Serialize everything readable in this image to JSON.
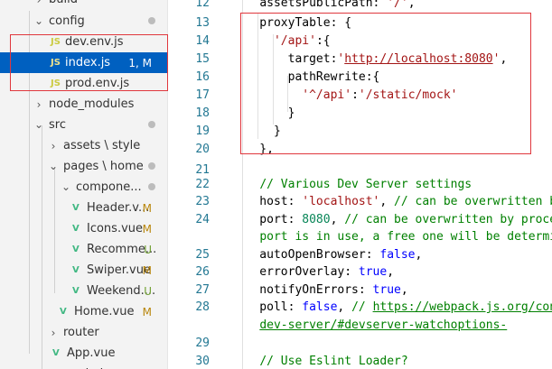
{
  "explorer": {
    "items": [
      {
        "type": "folder",
        "name": "build",
        "open": false
      },
      {
        "type": "folder",
        "name": "config",
        "open": true,
        "dot": true
      },
      {
        "type": "file",
        "kind": "js",
        "name": "dev.env.js"
      },
      {
        "type": "file",
        "kind": "js",
        "name": "index.js",
        "badge": "1, M",
        "selected": true
      },
      {
        "type": "file",
        "kind": "js",
        "name": "prod.env.js"
      },
      {
        "type": "folder",
        "name": "node_modules",
        "open": false
      },
      {
        "type": "folder",
        "name": "src",
        "open": true,
        "dot": true
      },
      {
        "type": "folder",
        "name": "assets \\ style",
        "open": false
      },
      {
        "type": "folder",
        "name": "pages \\ home",
        "open": true,
        "dot": true
      },
      {
        "type": "folder",
        "name": "compone...",
        "open": true,
        "dot": true
      },
      {
        "type": "file",
        "kind": "vue",
        "name": "Header.v...",
        "badge": "M"
      },
      {
        "type": "file",
        "kind": "vue",
        "name": "Icons.vue",
        "badge": "M"
      },
      {
        "type": "file",
        "kind": "vue",
        "name": "Recomme...",
        "badge": "U"
      },
      {
        "type": "file",
        "kind": "vue",
        "name": "Swiper.vue",
        "badge": "M"
      },
      {
        "type": "file",
        "kind": "vue",
        "name": "Weekend....",
        "badge": "U"
      },
      {
        "type": "file",
        "kind": "vue",
        "name": "Home.vue",
        "badge": "M"
      },
      {
        "type": "folder",
        "name": "router",
        "open": false
      },
      {
        "type": "file",
        "kind": "vue",
        "name": "App.vue"
      },
      {
        "type": "file",
        "kind": "js",
        "name": "main.js"
      }
    ]
  },
  "icons": {
    "js": "JS",
    "vue": "V",
    "chevron_right": "›",
    "chevron_down": "⌄"
  },
  "editor": {
    "lines": [
      {
        "n": "12",
        "t": [
          [
            "    ",
            ""
          ],
          [
            "assetsPublicPath",
            ""
          ],
          [
            ": ",
            ""
          ],
          [
            "'/'",
            "s"
          ],
          [
            ",",
            ""
          ]
        ]
      },
      {
        "n": "13",
        "t": [
          [
            "    proxyTable: {",
            ""
          ]
        ]
      },
      {
        "n": "14",
        "t": [
          [
            "      ",
            ""
          ],
          [
            "'/api'",
            "s"
          ],
          [
            ":{",
            ""
          ]
        ]
      },
      {
        "n": "15",
        "t": [
          [
            "        target:",
            ""
          ],
          [
            "'",
            "s"
          ],
          [
            "http://localhost:8080",
            "u"
          ],
          [
            "'",
            "s"
          ],
          [
            ",",
            ""
          ]
        ]
      },
      {
        "n": "16",
        "t": [
          [
            "        pathRewrite:{",
            ""
          ]
        ]
      },
      {
        "n": "17",
        "t": [
          [
            "          ",
            ""
          ],
          [
            "'^/api'",
            "s"
          ],
          [
            ":",
            ""
          ],
          [
            "'/static/mock'",
            "s"
          ]
        ]
      },
      {
        "n": "18",
        "t": [
          [
            "        }",
            ""
          ]
        ]
      },
      {
        "n": "19",
        "t": [
          [
            "      }",
            ""
          ]
        ]
      },
      {
        "n": "20",
        "t": [
          [
            "    },",
            ""
          ]
        ]
      },
      {
        "n": "21",
        "t": [
          [
            "",
            ""
          ]
        ]
      },
      {
        "n": "22",
        "t": [
          [
            "    ",
            ""
          ],
          [
            "// Various Dev Server settings",
            "c"
          ]
        ]
      },
      {
        "n": "23",
        "t": [
          [
            "    host: ",
            ""
          ],
          [
            "'localhost'",
            "s"
          ],
          [
            ", ",
            ""
          ],
          [
            "// can be overwritten by process.env.HOST",
            "c"
          ]
        ]
      },
      {
        "n": "24",
        "t": [
          [
            "    port: ",
            ""
          ],
          [
            "8080",
            "n"
          ],
          [
            ", ",
            ""
          ],
          [
            "// can be overwritten by process.env.PORT, if",
            "c"
          ]
        ]
      },
      {
        "n": "",
        "t": [
          [
            "    ",
            ""
          ],
          [
            "port is in use, a free one will be determined",
            "c"
          ]
        ]
      },
      {
        "n": "25",
        "t": [
          [
            "    autoOpenBrowser: ",
            ""
          ],
          [
            "false",
            "b"
          ],
          [
            ",",
            ""
          ]
        ]
      },
      {
        "n": "26",
        "t": [
          [
            "    errorOverlay: ",
            ""
          ],
          [
            "true",
            "b"
          ],
          [
            ",",
            ""
          ]
        ]
      },
      {
        "n": "27",
        "t": [
          [
            "    notifyOnErrors: ",
            ""
          ],
          [
            "true",
            "b"
          ],
          [
            ",",
            ""
          ]
        ]
      },
      {
        "n": "28",
        "t": [
          [
            "    poll: ",
            ""
          ],
          [
            "false",
            "b"
          ],
          [
            ", ",
            ""
          ],
          [
            "// ",
            "c"
          ],
          [
            "https://webpack.js.org/configuration/",
            "cl"
          ]
        ]
      },
      {
        "n": "",
        "t": [
          [
            "    ",
            ""
          ],
          [
            "dev-server/#devserver-watchoptions-",
            "cl"
          ]
        ]
      },
      {
        "n": "",
        "t": [
          [
            "",
            ""
          ]
        ]
      },
      {
        "n": "29",
        "t": [
          [
            "",
            ""
          ]
        ]
      },
      {
        "n": "30",
        "t": [
          [
            "    ",
            ""
          ],
          [
            "// Use Eslint Loader?",
            "c"
          ]
        ]
      }
    ]
  }
}
